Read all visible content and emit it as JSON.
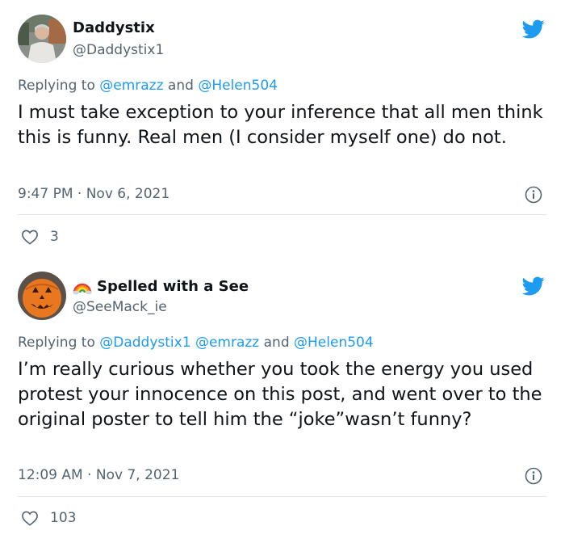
{
  "tweets": [
    {
      "display_name": "Daddystix",
      "handle": "@Daddystix1",
      "replying_prefix": "Replying to ",
      "replying_mentions": [
        "@emrazz",
        "@Helen504"
      ],
      "replying_joiners": [
        " and "
      ],
      "text": "I must take exception to your inference that all men think this is funny. Real men (I consider myself one) do not.",
      "timestamp": "9:47 PM · Nov 6, 2021",
      "likes": "3"
    },
    {
      "display_name": "Spelled with a See",
      "name_emoji": "rainbow-icon",
      "handle": "@SeeMack_ie",
      "replying_prefix": "Replying to ",
      "replying_mentions": [
        "@Daddystix1",
        "@emrazz",
        "@Helen504"
      ],
      "replying_joiners": [
        " ",
        " and "
      ],
      "text": "I’m really curious whether you took the energy you used protest your innocence on this post, and went over to the original poster to tell him the “joke”wasn’t funny?",
      "timestamp": "12:09 AM · Nov 7, 2021",
      "likes": "103"
    }
  ],
  "colors": {
    "brand_blue": "#1d9bf0",
    "muted_text": "#536471",
    "separator": "#e6ecf0"
  }
}
